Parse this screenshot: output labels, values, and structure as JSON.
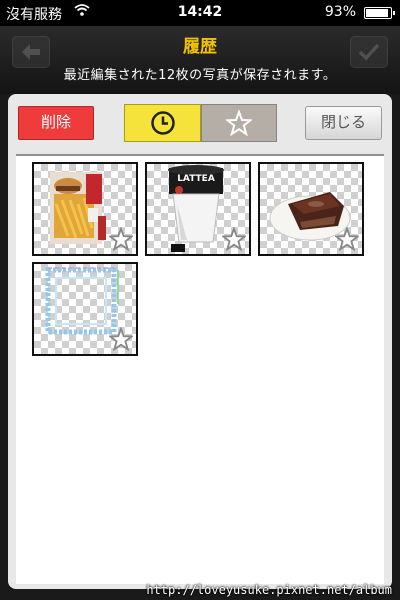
{
  "status_bar": {
    "carrier": "沒有服務",
    "time": "14:42",
    "battery": "93%",
    "battery_level": 0.93,
    "wifi_icon": "wifi-icon",
    "battery_icon": "battery-icon"
  },
  "header": {
    "title": "履歴",
    "subtitle": "最近編集された12枚の写真が保存されます。",
    "back_icon": "arrow-left-icon",
    "confirm_icon": "checkmark-icon"
  },
  "toolbar": {
    "delete_label": "削除",
    "history_icon": "clock-icon",
    "favorite_icon": "star-icon",
    "close_label": "閉じる",
    "active_tab": "history"
  },
  "photos": [
    {
      "subject": "burger-fries",
      "favorite_icon": "star-outline-icon",
      "favorited": false
    },
    {
      "subject": "latte-cup",
      "label": "LATTEA",
      "favorite_icon": "star-outline-icon",
      "favorited": false
    },
    {
      "subject": "chocolate-cake",
      "favorite_icon": "star-outline-icon",
      "favorited": false
    },
    {
      "subject": "blue-frame",
      "favorite_icon": "star-outline-icon",
      "favorited": false
    }
  ],
  "watermark": "http://loveyusuke.pixnet.net/album",
  "colors": {
    "title": "#f2c200",
    "delete": "#ee3b3b",
    "history_tab": "#f5e23a",
    "favorite_tab": "#b5aea6"
  }
}
